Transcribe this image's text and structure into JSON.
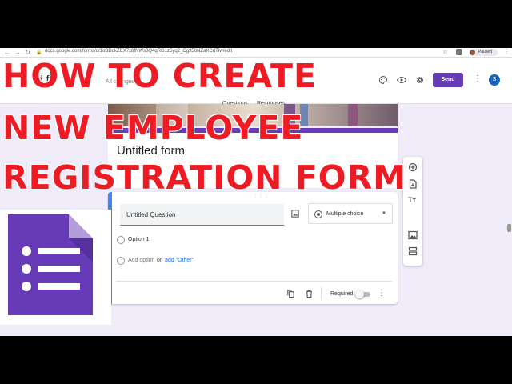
{
  "browser": {
    "url": "docs.google.com/forms/d/1oBDdkZEX7x8fNWs3Q4qRG1z5yq2_Cg356NZaXCdTIw/edit",
    "profile_status": "Paused"
  },
  "header": {
    "partial_title": "d f",
    "all_changes": "All changes",
    "send_label": "Send",
    "avatar_letter": "S"
  },
  "tabs": [
    {
      "label": "Questions"
    },
    {
      "label": "Responses"
    }
  ],
  "form": {
    "title": "Untitled form"
  },
  "question": {
    "placeholder": "Untitled Question",
    "type": "Multiple choice",
    "option1": "Option 1",
    "add_option": "Add option",
    "or": "or",
    "add_other": "add \"Other\"",
    "required_label": "Required"
  },
  "toolbar": {
    "text_icon_label": "Tт"
  },
  "overlay": {
    "line1": "HOW TO CREATE",
    "line2": "NEW EMPLOYEE",
    "line3": "REGISTRATION FORM"
  },
  "colors": {
    "accent": "#673ab7",
    "overlay_text": "#ed1c24",
    "question_focus": "#4285f4"
  }
}
